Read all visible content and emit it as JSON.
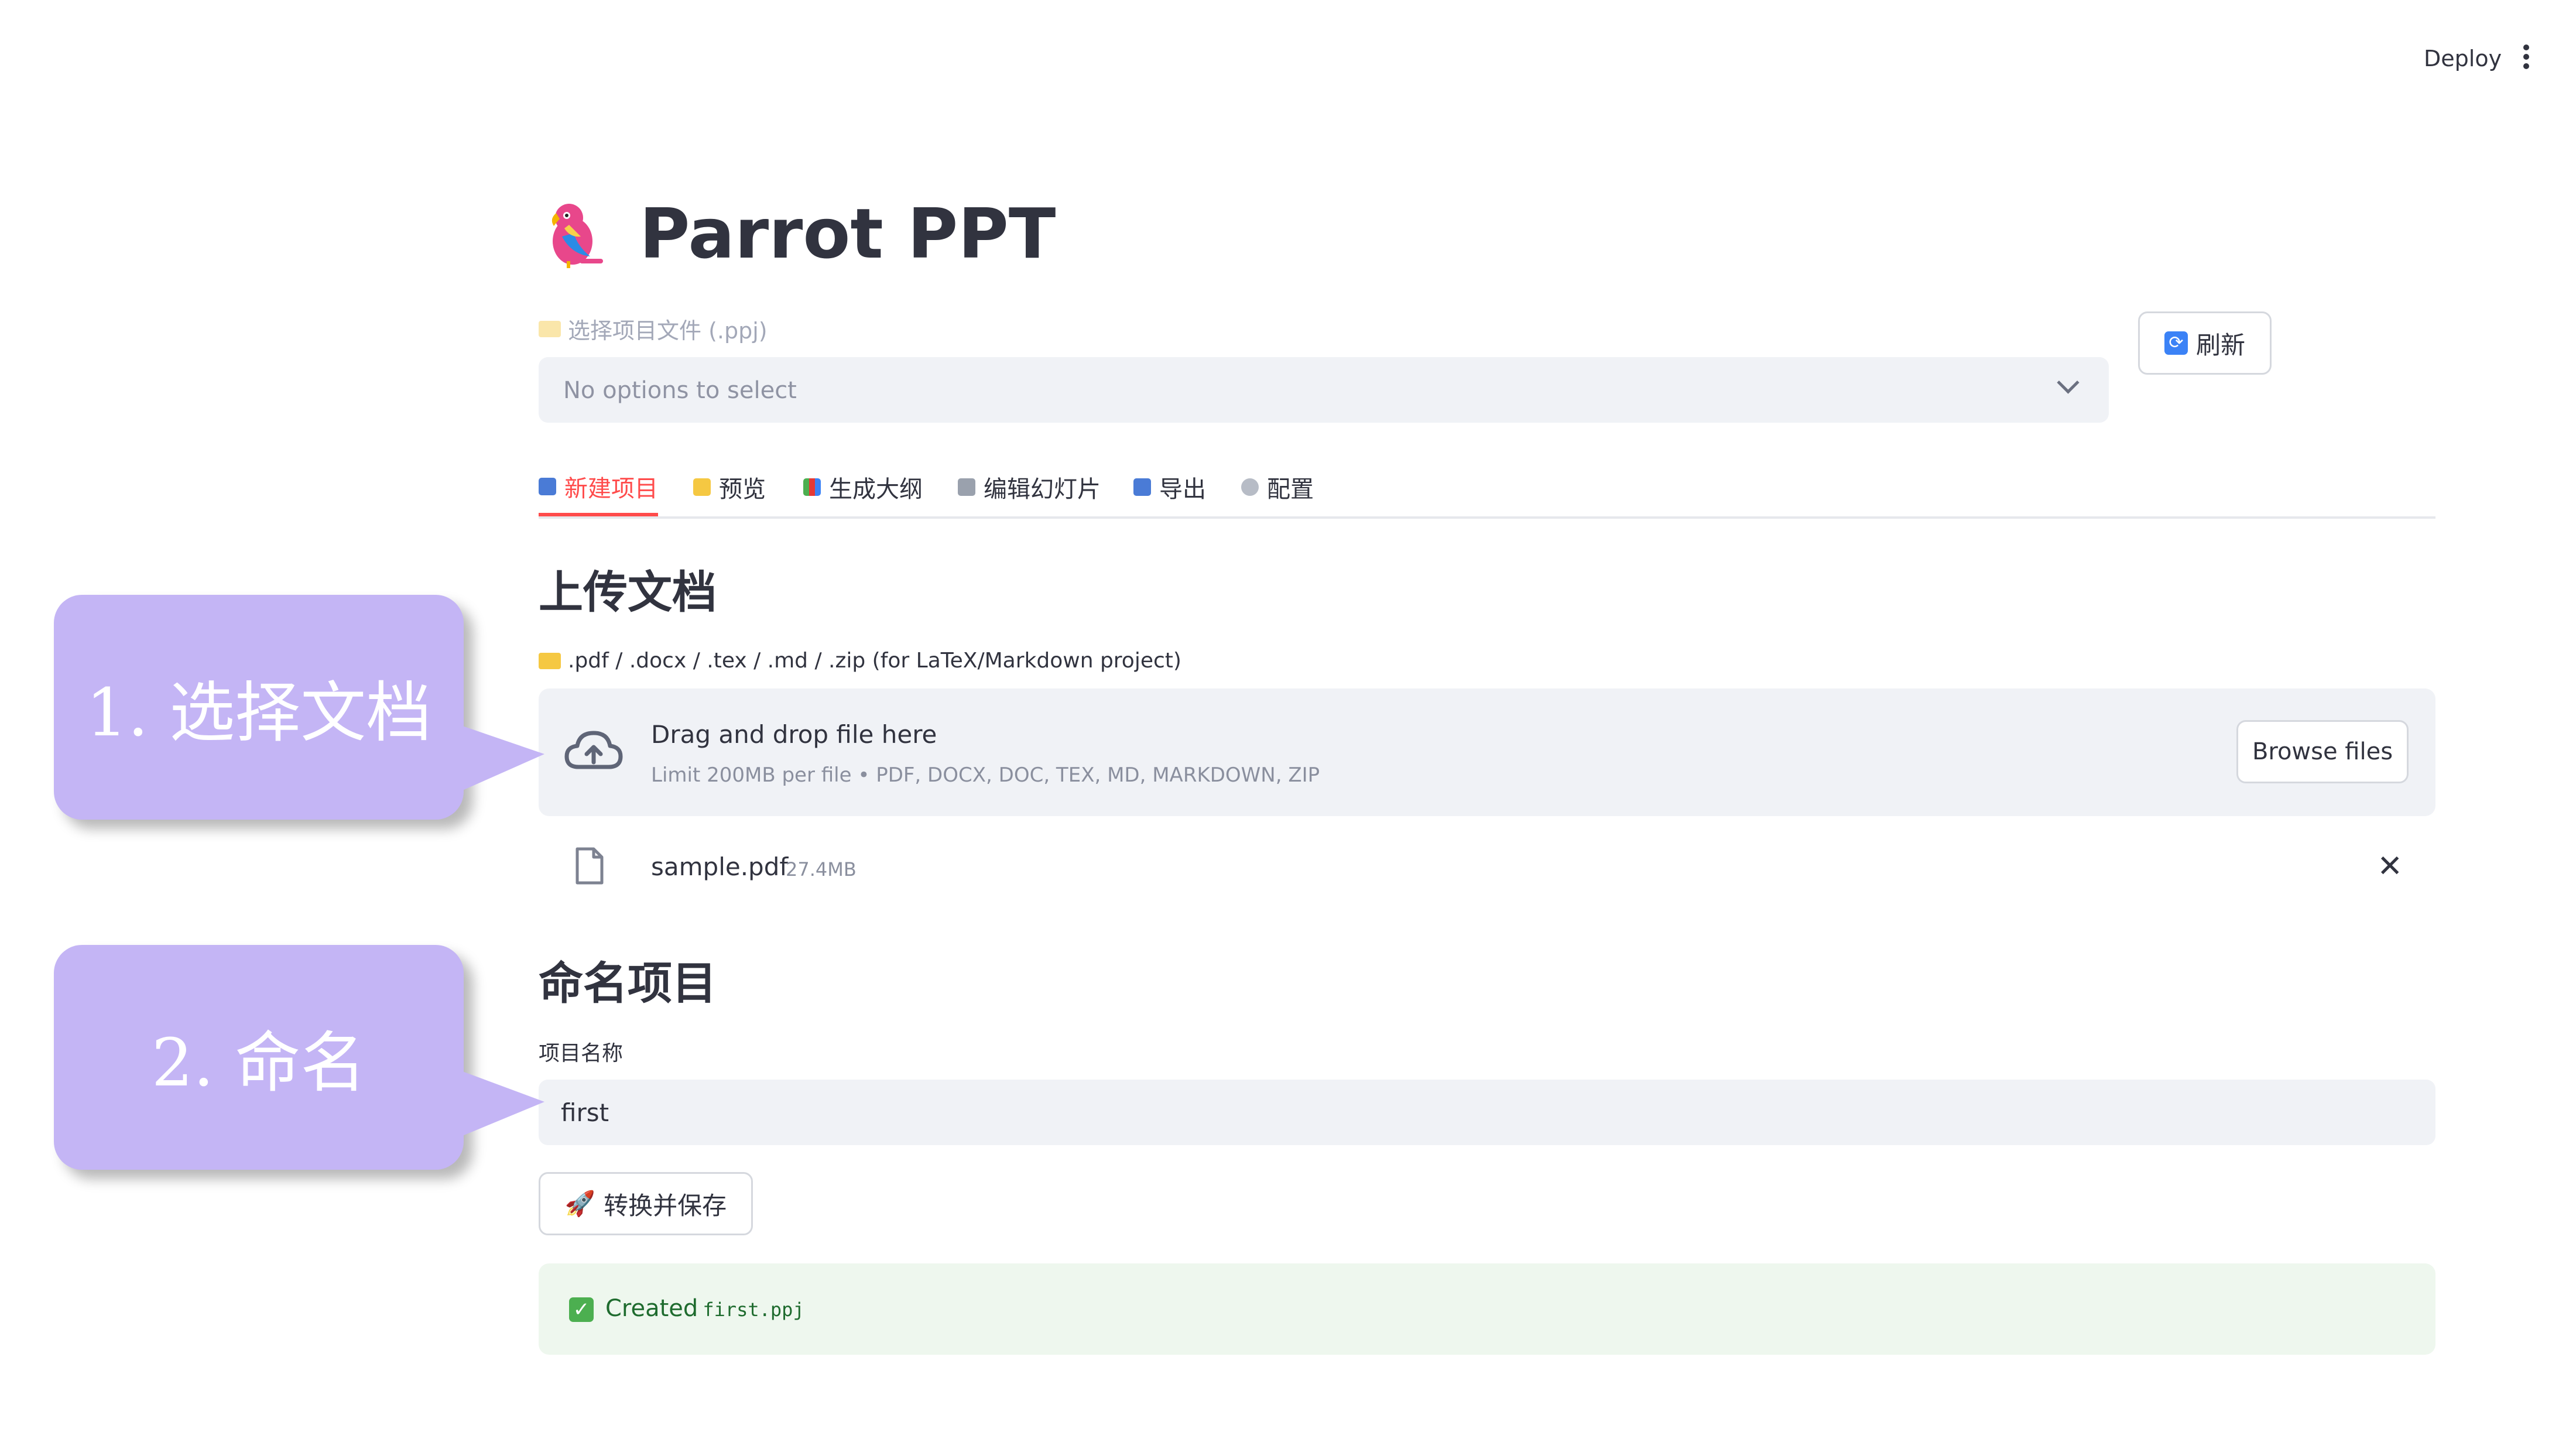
{
  "topbar": {
    "deploy_label": "Deploy",
    "menu_icon": "kebab-menu-icon"
  },
  "header": {
    "title": "Parrot PPT",
    "logo_icon": "parrot-icon"
  },
  "project_select": {
    "label": "选择项目文件 (.ppj)",
    "placeholder": "No options to select",
    "refresh_label": "刷新"
  },
  "tabs": [
    {
      "label": "新建项目",
      "icon": "inbox-tray-icon",
      "active": true
    },
    {
      "label": "预览",
      "icon": "folder-icon",
      "active": false
    },
    {
      "label": "生成大纲",
      "icon": "books-icon",
      "active": false
    },
    {
      "label": "编辑幻灯片",
      "icon": "tools-icon",
      "active": false
    },
    {
      "label": "导出",
      "icon": "outbox-tray-icon",
      "active": false
    },
    {
      "label": "配置",
      "icon": "gear-icon",
      "active": false
    }
  ],
  "upload": {
    "heading": "上传文档",
    "hint": ".pdf / .docx / .tex / .md / .zip (for LaTeX/Markdown project)",
    "drop_title": "Drag and drop file here",
    "drop_sub": "Limit 200MB per file • PDF, DOCX, DOC, TEX, MD, MARKDOWN, ZIP",
    "browse_label": "Browse files",
    "file": {
      "name": "sample.pdf",
      "size": "27.4MB"
    }
  },
  "naming": {
    "heading": "命名项目",
    "field_label": "项目名称",
    "value": "first",
    "convert_label": "转换并保存"
  },
  "status": {
    "text": "Created",
    "code": "first.ppj"
  },
  "callouts": [
    {
      "text": "1. 选择文档"
    },
    {
      "text": "2. 命名"
    }
  ],
  "colors": {
    "accent": "#ff4b4b",
    "callout": "#c4b5f5",
    "success_bg": "#eef7ee"
  }
}
